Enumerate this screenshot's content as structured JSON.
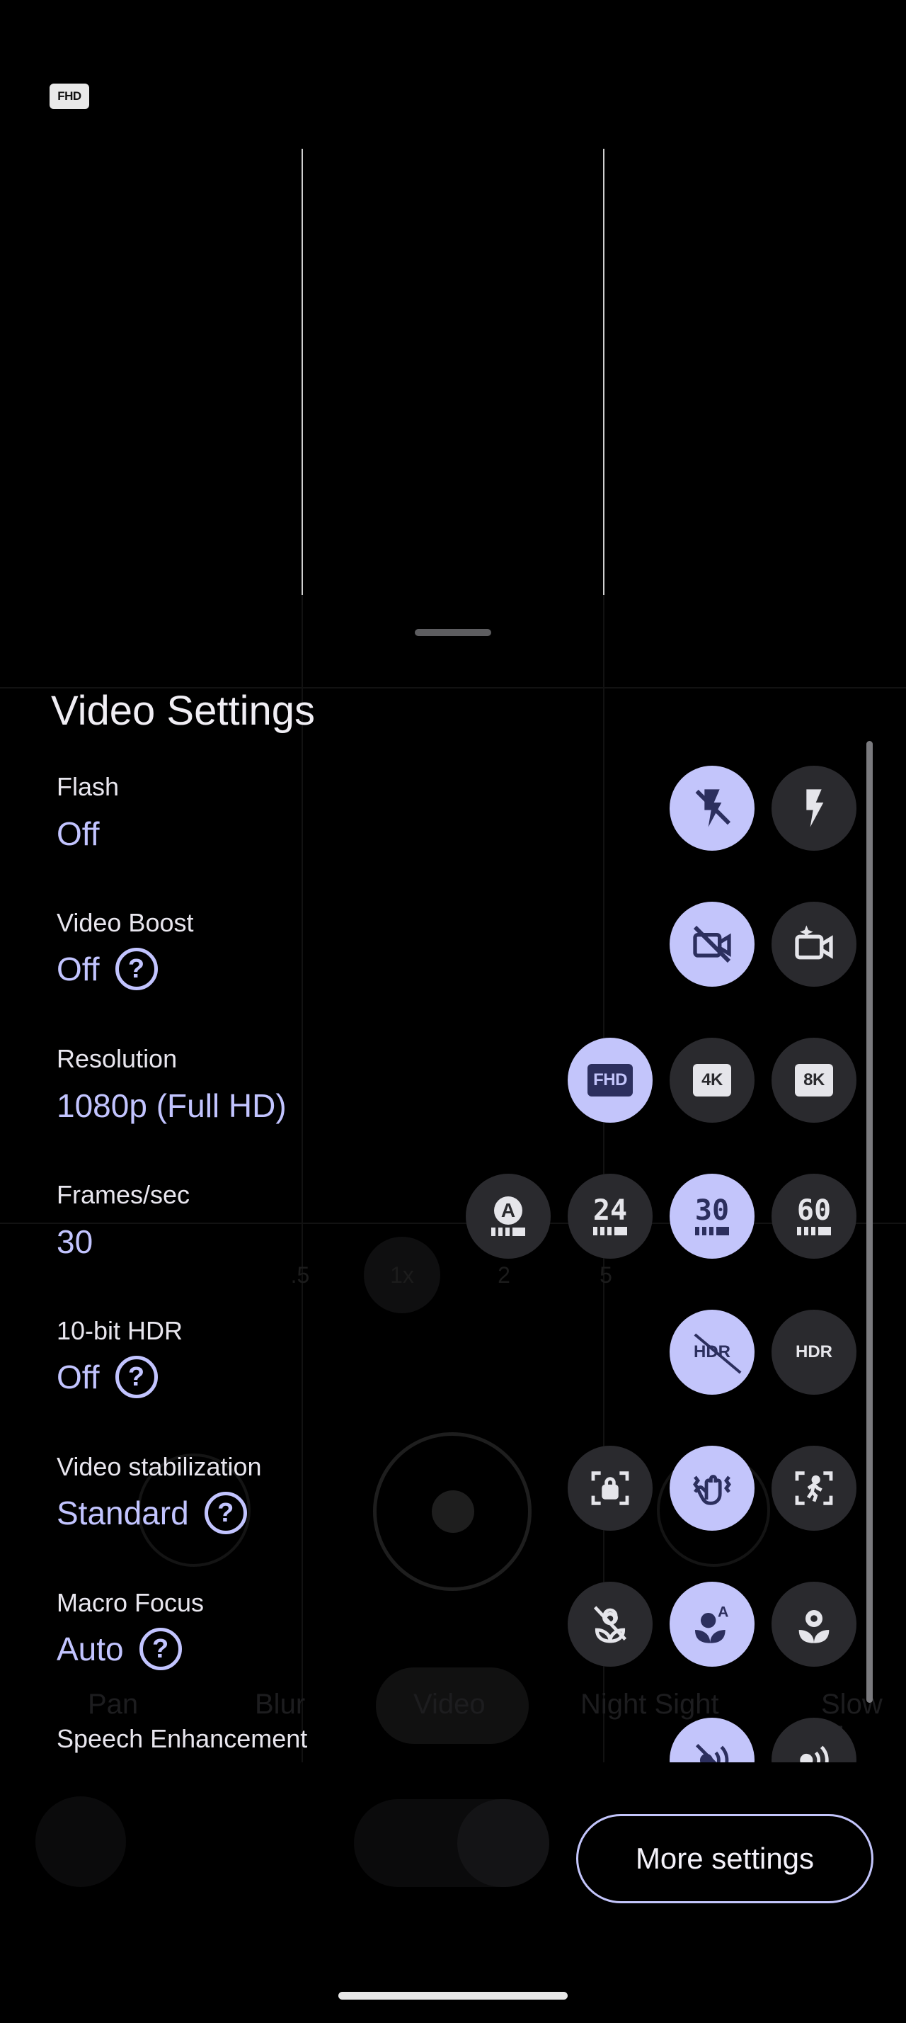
{
  "status": {
    "resolution_badge": "FHD"
  },
  "background": {
    "zoom_levels": [
      ".5",
      "1x",
      "2",
      "5"
    ],
    "modes": [
      "Pan",
      "Blur",
      "Video",
      "Night Sight",
      "Slow M"
    ]
  },
  "sheet": {
    "title": "Video Settings",
    "rows": [
      {
        "label": "Flash",
        "value": "Off",
        "help": false,
        "options": [
          {
            "icon": "flash-off-icon",
            "selected": true
          },
          {
            "icon": "flash-on-icon",
            "selected": false
          }
        ]
      },
      {
        "label": "Video Boost",
        "value": "Off",
        "help": true,
        "options": [
          {
            "icon": "video-boost-off-icon",
            "selected": true
          },
          {
            "icon": "video-boost-on-icon",
            "selected": false
          }
        ]
      },
      {
        "label": "Resolution",
        "value": "1080p (Full HD)",
        "help": false,
        "options": [
          {
            "icon": "FHD",
            "selected": true
          },
          {
            "icon": "4K",
            "selected": false
          },
          {
            "icon": "8K",
            "selected": false
          }
        ]
      },
      {
        "label": "Frames/sec",
        "value": "30",
        "help": false,
        "options": [
          {
            "icon": "A",
            "selected": false
          },
          {
            "icon": "24",
            "selected": false
          },
          {
            "icon": "30",
            "selected": true
          },
          {
            "icon": "60",
            "selected": false
          }
        ]
      },
      {
        "label": "10-bit HDR",
        "value": "Off",
        "help": true,
        "options": [
          {
            "icon": "HDR",
            "selected": true
          },
          {
            "icon": "HDR",
            "selected": false
          }
        ]
      },
      {
        "label": "Video stabilization",
        "value": "Standard",
        "help": true,
        "options": [
          {
            "icon": "stabilization-locked-icon",
            "selected": false
          },
          {
            "icon": "stabilization-standard-icon",
            "selected": true
          },
          {
            "icon": "stabilization-active-icon",
            "selected": false
          }
        ]
      },
      {
        "label": "Macro Focus",
        "value": "Auto",
        "help": true,
        "options": [
          {
            "icon": "macro-off-icon",
            "selected": false
          },
          {
            "icon": "macro-auto-icon",
            "selected": true
          },
          {
            "icon": "macro-on-icon",
            "selected": false
          }
        ]
      },
      {
        "label": "Speech Enhancement",
        "value": "",
        "help": false,
        "options": [
          {
            "icon": "speech-off-icon",
            "selected": true
          },
          {
            "icon": "speech-on-icon",
            "selected": false
          }
        ]
      }
    ],
    "more_settings_label": "More settings"
  },
  "colors": {
    "accent": "#c3c5fb",
    "option_bg": "#2a2a2e",
    "sheet_bg": "#000000"
  }
}
